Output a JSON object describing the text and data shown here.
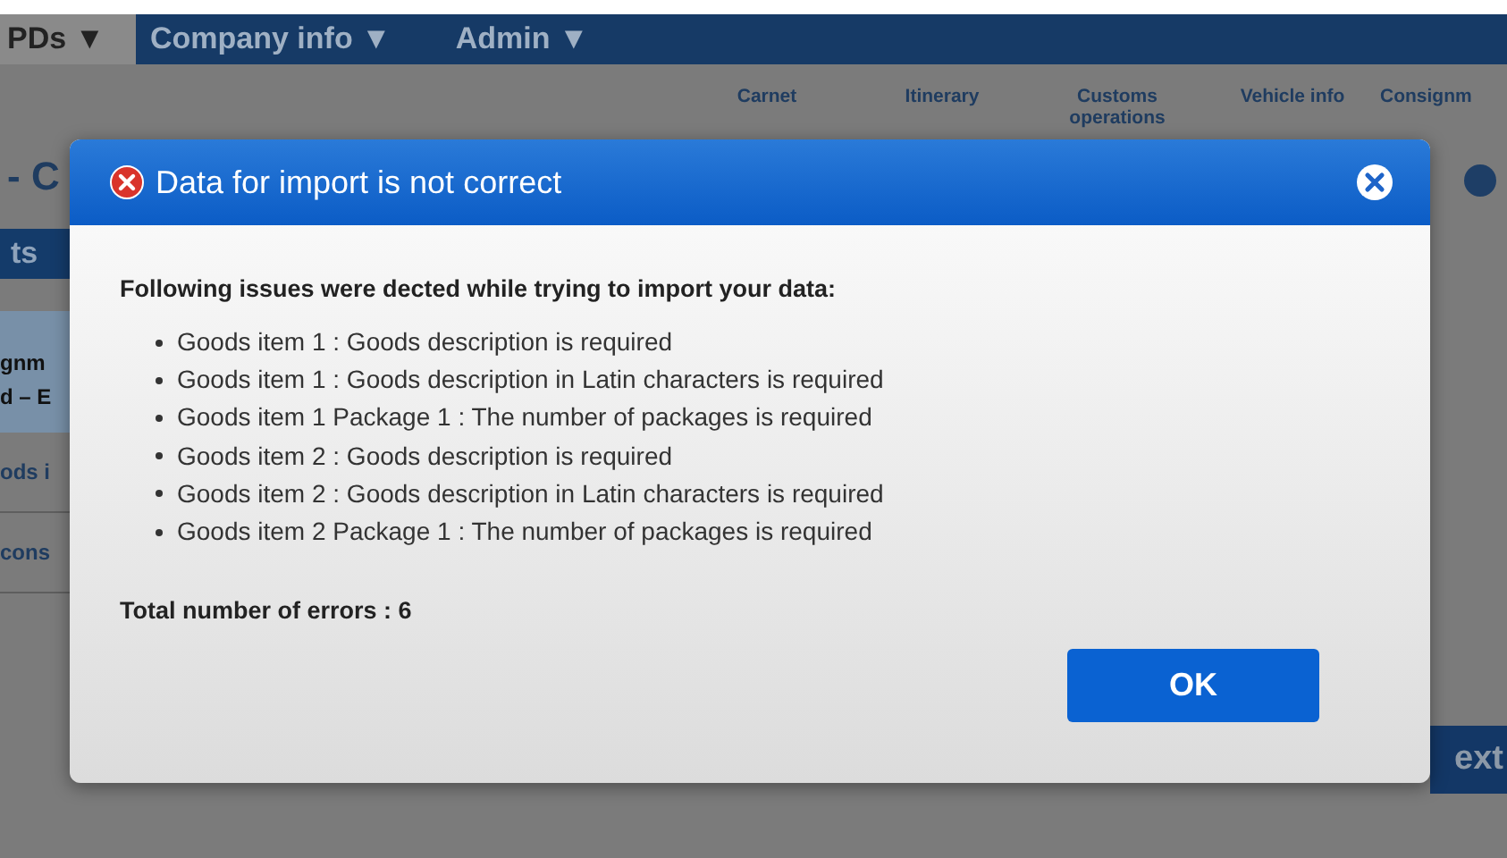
{
  "nav": {
    "tabs": [
      {
        "label": "PDs ▼",
        "selected": true
      },
      {
        "label": "Company info ▼",
        "selected": false
      },
      {
        "label": "Admin ▼",
        "selected": false
      }
    ]
  },
  "steps": [
    "Carnet",
    "Itinerary",
    "Customs operations",
    "Vehicle info",
    "Consignm"
  ],
  "page_heading": "- C",
  "left_fragments": [
    {
      "text": "ts",
      "kind": "button"
    },
    {
      "text": "gnm\nd – E",
      "kind": "panel"
    },
    {
      "text": "ods i",
      "kind": "link"
    },
    {
      "text": "cons",
      "kind": "link"
    }
  ],
  "next_button": "ext",
  "dialog": {
    "title": "Data for import is not correct",
    "intro": "Following issues were dected while trying to import your data:",
    "issues": [
      "Goods item 1 : Goods description is required",
      "Goods item 1 : Goods description in Latin characters is required",
      "Goods item 1 Package 1 : The number of packages is required",
      "Goods item 2 : Goods description is required",
      "Goods item 2 : Goods description in Latin characters is required",
      "Goods item 2 Package 1 : The number of packages is required"
    ],
    "total": "Total number of errors : 6",
    "ok_button": "OK"
  }
}
